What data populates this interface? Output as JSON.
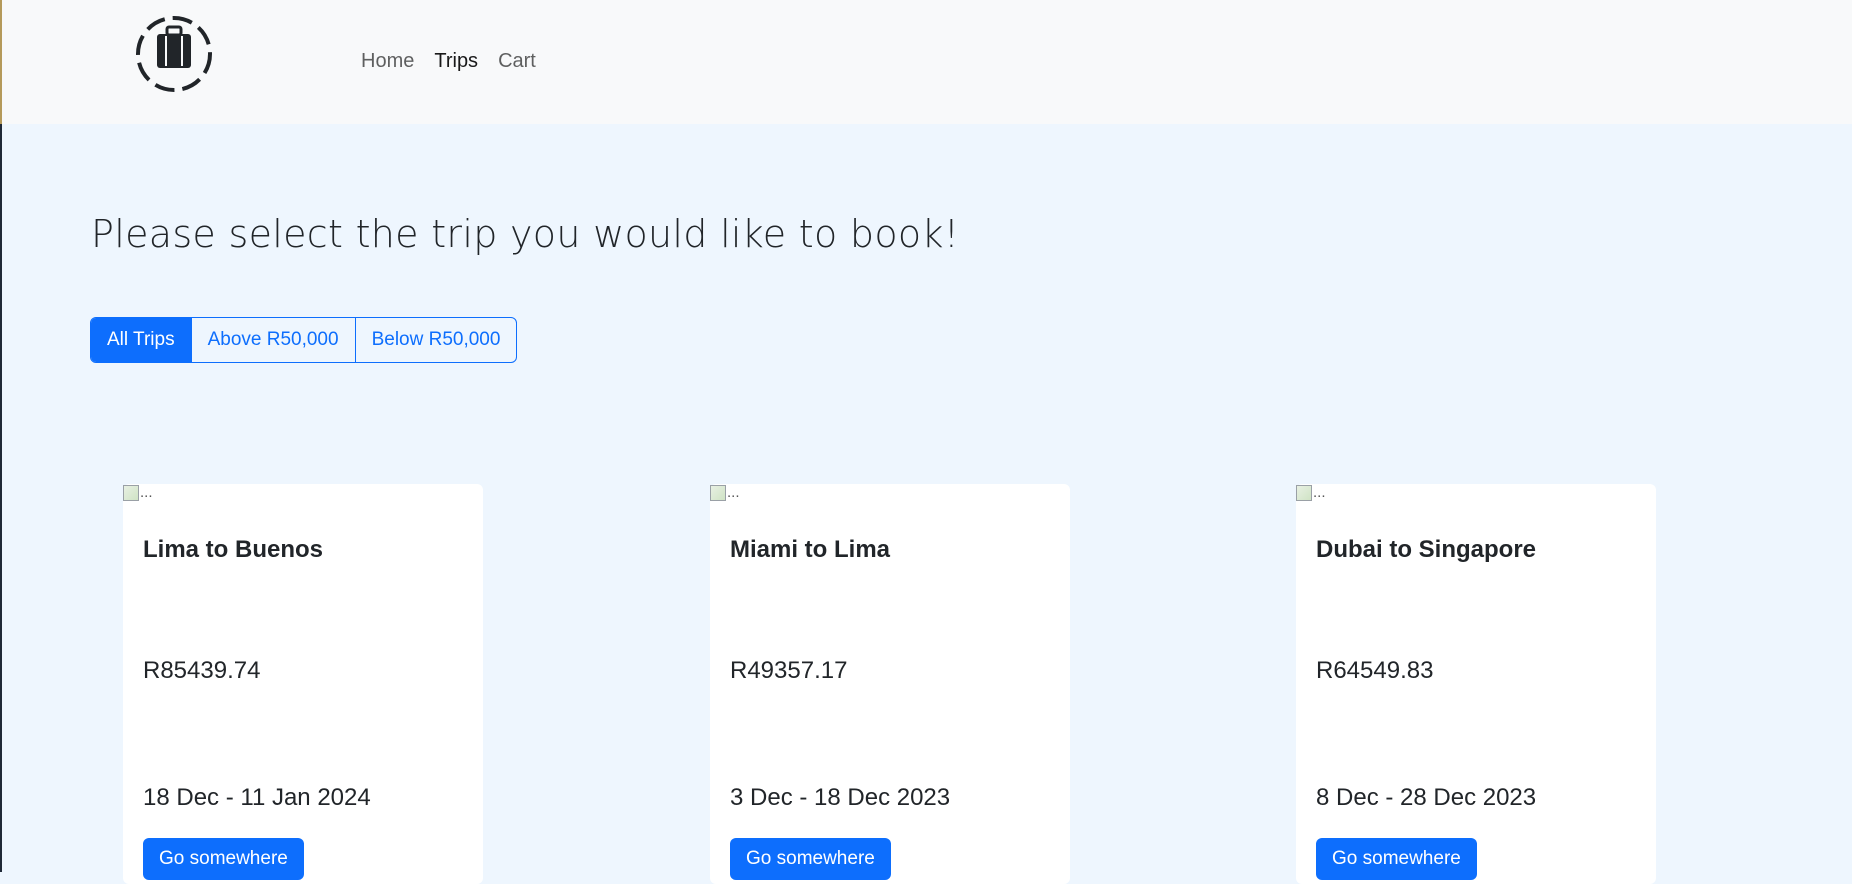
{
  "navbar": {
    "logo_icon": "suitcase-logo-icon",
    "links": [
      {
        "label": "Home",
        "active": false
      },
      {
        "label": "Trips",
        "active": true
      },
      {
        "label": "Cart",
        "active": false
      }
    ]
  },
  "main": {
    "heading": "Please select the trip you would like to book!",
    "filters": [
      {
        "label": "All Trips",
        "active": true
      },
      {
        "label": "Above R50,000",
        "active": false
      },
      {
        "label": "Below R50,000",
        "active": false
      }
    ],
    "trips": [
      {
        "image_alt": "...",
        "title": "Lima to Buenos",
        "price": "R85439.74",
        "dates": "18 Dec - 11 Jan 2024",
        "button": "Go somewhere"
      },
      {
        "image_alt": "...",
        "title": "Miami to Lima",
        "price": "R49357.17",
        "dates": "3 Dec - 18 Dec 2023",
        "button": "Go somewhere"
      },
      {
        "image_alt": "...",
        "title": "Dubai to Singapore",
        "price": "R64549.83",
        "dates": "8 Dec - 28 Dec 2023",
        "button": "Go somewhere"
      }
    ]
  },
  "colors": {
    "primary": "#0d6efd",
    "navbar_bg": "#f8f9fa",
    "page_bg": "#eef6fe",
    "text": "#212529"
  }
}
